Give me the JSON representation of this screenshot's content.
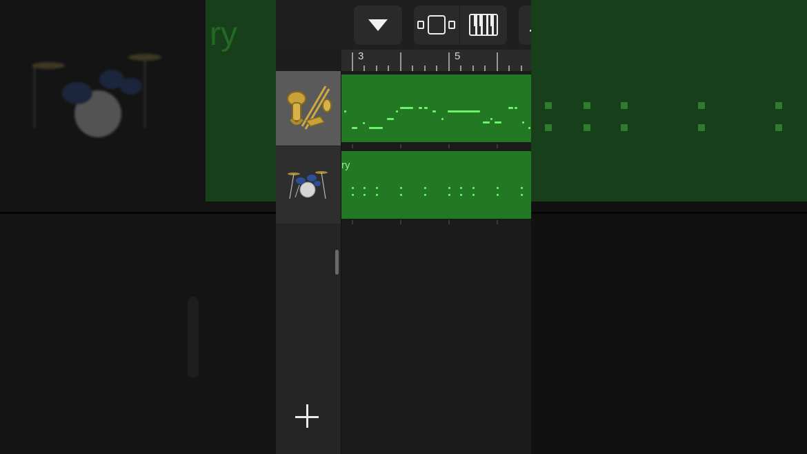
{
  "toolbar": {
    "buttons": [
      {
        "name": "dropdown",
        "icon": "triangle-down-icon"
      },
      {
        "name": "tracks-view",
        "icon": "tracks-view-icon"
      },
      {
        "name": "piano-roll",
        "icon": "piano-keys-icon"
      },
      {
        "name": "more",
        "icon": "partial-glyph-icon",
        "glyph": "♩"
      }
    ]
  },
  "ruler": {
    "bar_numbers": [
      "3",
      "5"
    ]
  },
  "tracks": [
    {
      "name": "brass",
      "icon": "brass-instrument-icon",
      "selected": true,
      "region_label": ""
    },
    {
      "name": "drums",
      "icon": "drum-kit-icon",
      "selected": false,
      "region_label": "ry"
    }
  ],
  "background": {
    "ghost_text": "ry"
  },
  "colors": {
    "region_green": "#237823",
    "note_green": "#6cf26c",
    "selected_header": "#5a5a5a"
  }
}
